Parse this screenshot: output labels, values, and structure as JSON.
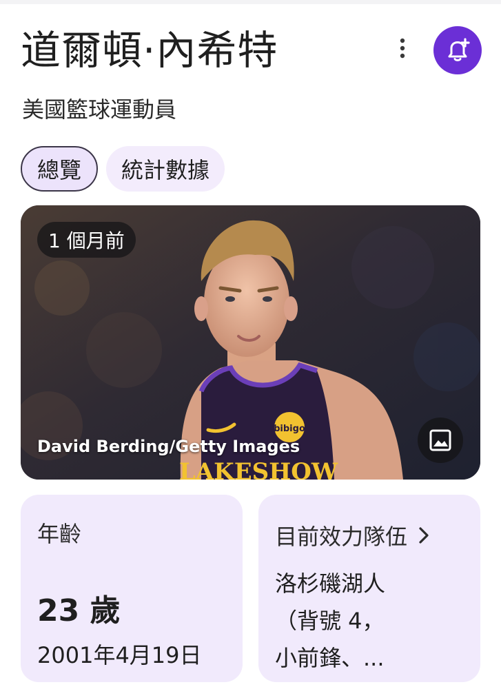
{
  "header": {
    "title": "道爾頓·內希特",
    "subtitle": "美國籃球運動員",
    "more_icon": "more-vertical-icon",
    "bell_icon": "bell-plus-icon"
  },
  "tabs": [
    {
      "label": "總覽",
      "active": true
    },
    {
      "label": "統計數據",
      "active": false
    }
  ],
  "hero": {
    "time_ago": "1 個月前",
    "credit": "David Berding/Getty Images",
    "image_icon": "image-icon",
    "jersey_text": "LAKESHOW",
    "badge_text": "bibigo"
  },
  "age_card": {
    "label": "年齡",
    "value": "23 歲",
    "birth_date": "2001年4月19日"
  },
  "team_card": {
    "label": "目前效力隊伍",
    "chevron_icon": "chevron-right-icon",
    "value": "洛杉磯湖人\n（背號 4，\n小前鋒、..."
  },
  "colors": {
    "accent": "#6b2fd6",
    "card_bg": "#f1eafc",
    "tab_bg": "#f3ecfc",
    "jersey": "#2a1c3d",
    "jersey_trim": "#6b3fb8",
    "jersey_gold": "#f2c230"
  }
}
